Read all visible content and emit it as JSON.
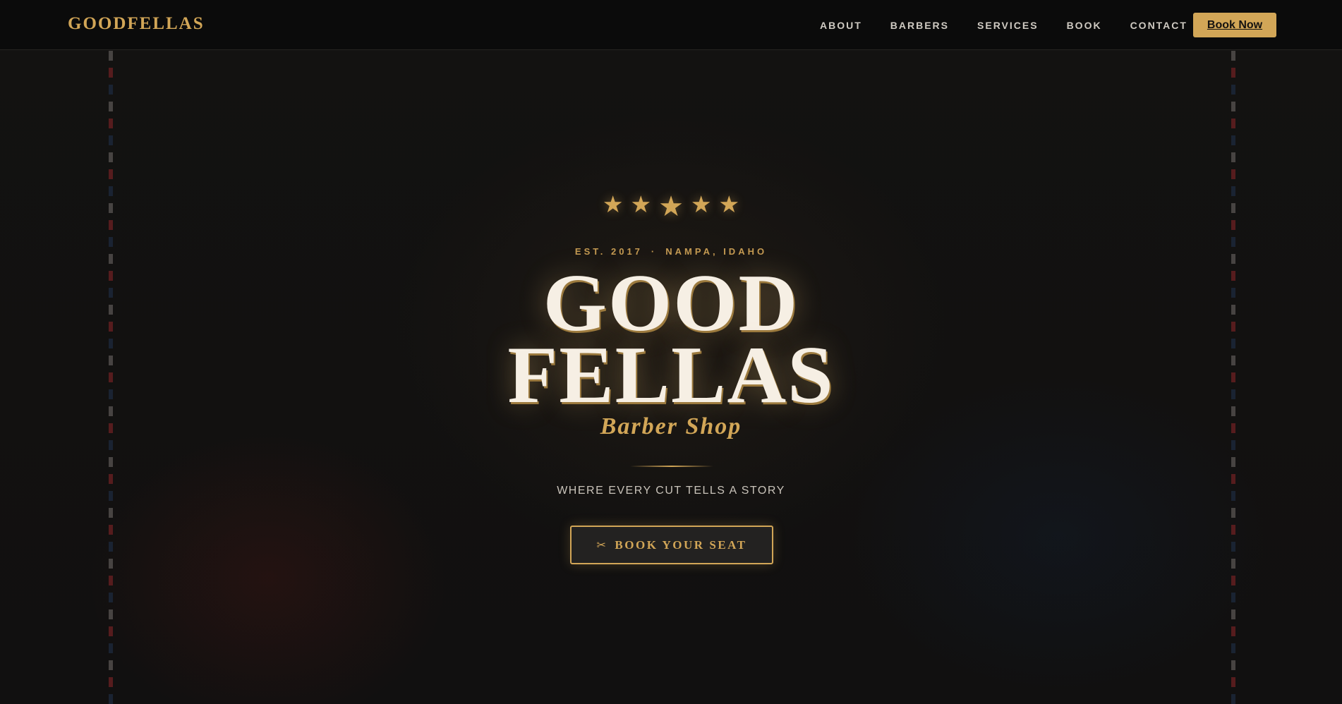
{
  "nav": {
    "brand": "GOODFELLAS",
    "links": [
      {
        "label": "ABOUT"
      },
      {
        "label": "BARBERS"
      },
      {
        "label": "SERVICES"
      },
      {
        "label": "BOOK"
      },
      {
        "label": "CONTACT"
      }
    ],
    "cta_label": "Book Now"
  },
  "hero": {
    "stars_icon": "star-icon",
    "star_glyph": "★",
    "star_count": 5,
    "established": "EST. 2017",
    "separator": "·",
    "location": "NAMPA, IDAHO",
    "title_line_1": "GOOD",
    "title_line_2": "FELLAS",
    "subtitle": "Barber Shop",
    "tagline": "WHERE EVERY CUT TELLS A STORY",
    "cta_icon": "scissors-icon",
    "cta_icon_glyph": "✂",
    "cta_label": "BOOK YOUR SEAT"
  },
  "colors": {
    "gold": "#d2a657",
    "cream": "#f6efe4",
    "background": "#111010"
  }
}
